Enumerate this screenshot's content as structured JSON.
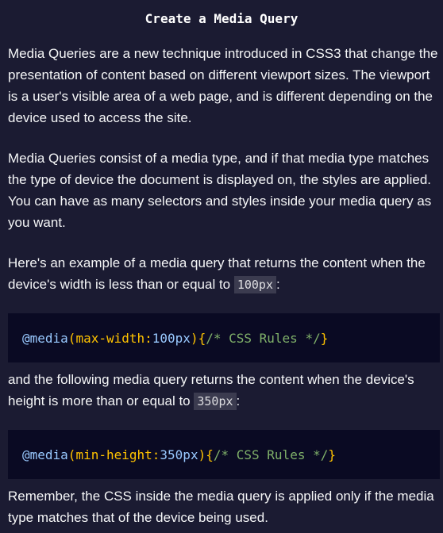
{
  "title": "Create a Media Query",
  "paragraphs": {
    "p1": "Media Queries are a new technique introduced in CSS3 that change the presentation of content based on different viewport sizes. The viewport is a user's visible area of a web page, and is different depending on the device used to access the site.",
    "p2": "Media Queries consist of a media type, and if that media type matches the type of device the document is displayed on, the styles are applied. You can have as many selectors and styles inside your media query as you want.",
    "p3_before": "Here's an example of a media query that returns the content when the device's width is less than or equal to ",
    "p3_code": "100px",
    "p3_after": ":",
    "p4_before": "and the following media query returns the content when the device's height is more than or equal to ",
    "p4_code": "350px",
    "p4_after": ":",
    "p5": "Remember, the CSS inside the media query is applied only if the media type matches that of the device being used."
  },
  "code1": {
    "at": "@media",
    "open_paren": "(",
    "prop": "max-width:",
    "value": "100px",
    "close_paren": ")",
    "open_brace": "{",
    "comment": "/* CSS Rules */",
    "close_brace": "}"
  },
  "code2": {
    "at": "@media",
    "open_paren": "(",
    "prop": "min-height:",
    "value": "350px",
    "close_paren": ")",
    "open_brace": "{",
    "comment": "/* CSS Rules */",
    "close_brace": "}"
  },
  "colors": {
    "background": "#1b1b32",
    "code_background": "#0a0a23",
    "inline_code_background": "#3b3b4f",
    "keyword": "#99c9ff",
    "punctuation": "#ffc300",
    "comment": "#7fb069"
  }
}
